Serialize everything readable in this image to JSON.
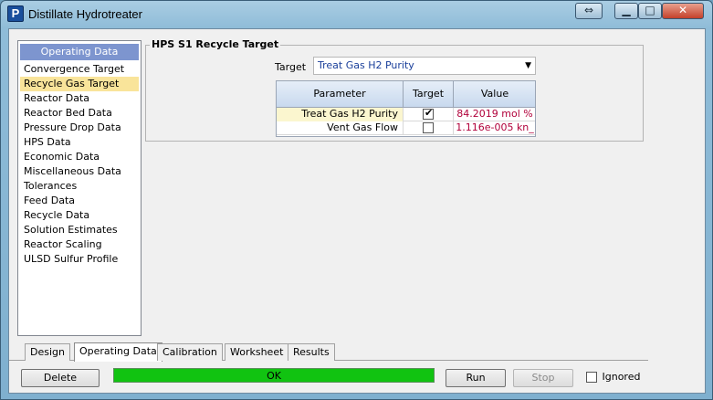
{
  "window": {
    "title": "Distillate Hydrotreater",
    "icon_letter": "P"
  },
  "title_buttons": {
    "arrows": "⇔",
    "minimize": "▁",
    "maximize": "□",
    "close": "✕"
  },
  "nav": {
    "header": "Operating Data",
    "items": [
      {
        "label": "Convergence Target"
      },
      {
        "label": "Recycle Gas Target",
        "selected": true
      },
      {
        "label": "Reactor Data"
      },
      {
        "label": "Reactor Bed Data"
      },
      {
        "label": "Pressure Drop Data"
      },
      {
        "label": "HPS Data"
      },
      {
        "label": "Economic Data"
      },
      {
        "label": "Miscellaneous Data"
      },
      {
        "label": "Tolerances"
      },
      {
        "label": "Feed Data"
      },
      {
        "label": "Recycle Data"
      },
      {
        "label": "Solution Estimates"
      },
      {
        "label": "Reactor Scaling"
      },
      {
        "label": "ULSD Sulfur Profile"
      }
    ]
  },
  "group": {
    "title": "HPS S1 Recycle Target",
    "target_label": "Target",
    "target_value": "Treat Gas H2 Purity"
  },
  "grid": {
    "headers": [
      "Parameter",
      "Target",
      "Value"
    ],
    "rows": [
      {
        "parameter": "Treat Gas H2 Purity",
        "checked": true,
        "value": "84.2019 mol %"
      },
      {
        "parameter": "Vent Gas Flow",
        "checked": false,
        "value": "1.116e-005 kn_"
      }
    ]
  },
  "tabs": [
    {
      "label": "Design"
    },
    {
      "label": "Operating Data",
      "active": true
    },
    {
      "label": "Calibration"
    },
    {
      "label": "Worksheet"
    },
    {
      "label": "Results"
    }
  ],
  "buttons": {
    "delete": "Delete",
    "run": "Run",
    "stop": "Stop"
  },
  "status": {
    "text": "OK",
    "color": "#11c311"
  },
  "ignored": {
    "label": "Ignored",
    "checked": false
  },
  "colors": {
    "nav_header": "#7d95cf",
    "nav_selected": "#f9e49a",
    "value_text": "#b1003a",
    "select_text": "#1a3f9a"
  }
}
